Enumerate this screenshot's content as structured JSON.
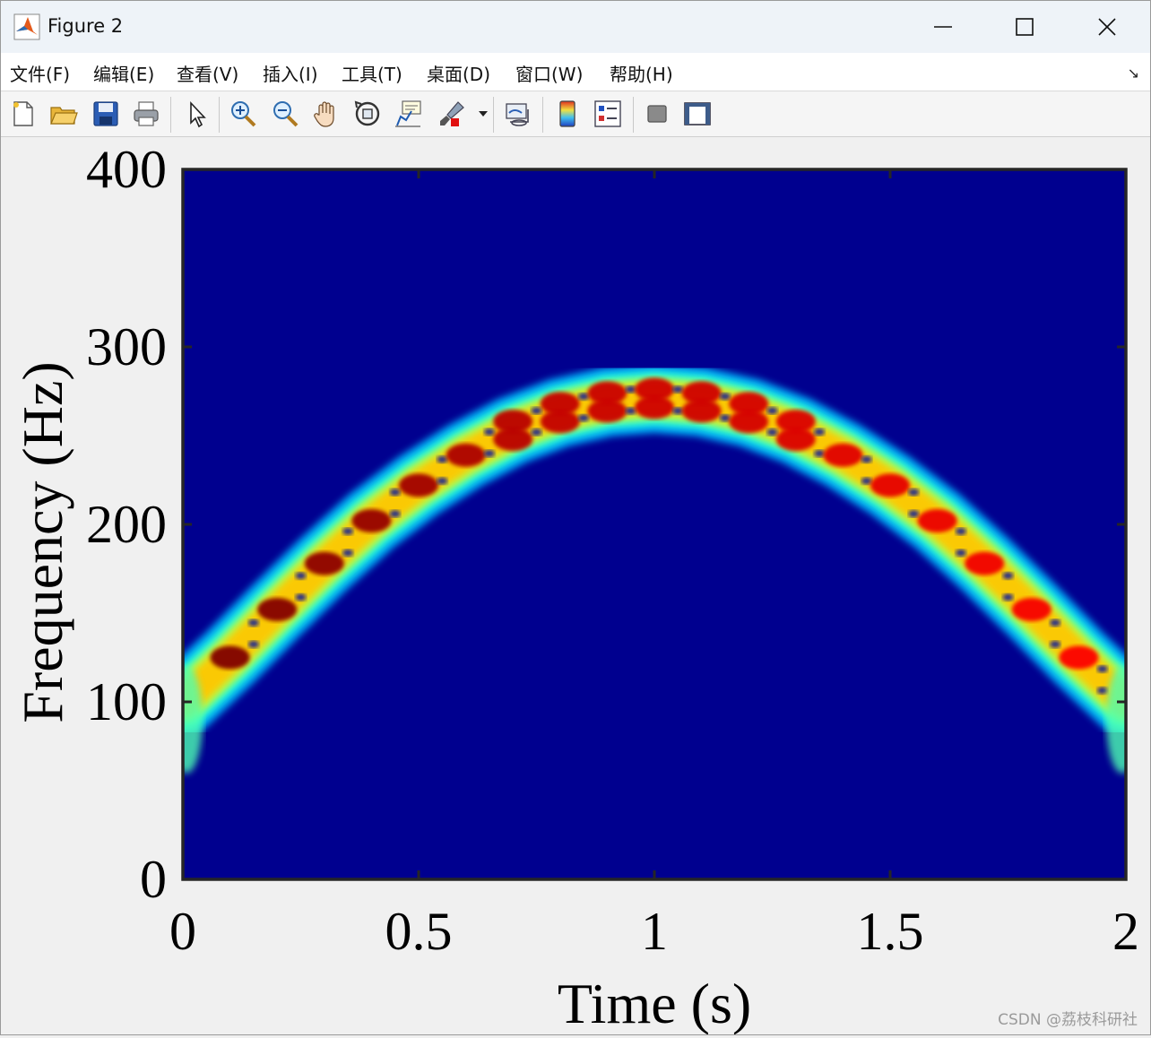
{
  "window": {
    "title": "Figure 2",
    "controls": {
      "minimize": "minimize",
      "maximize": "maximize",
      "close": "close"
    }
  },
  "menu": [
    {
      "label": "文件(F)"
    },
    {
      "label": "编辑(E)"
    },
    {
      "label": "查看(V)"
    },
    {
      "label": "插入(I)"
    },
    {
      "label": "工具(T)"
    },
    {
      "label": "桌面(D)"
    },
    {
      "label": "窗口(W)"
    },
    {
      "label": "帮助(H)"
    }
  ],
  "toolbar": {
    "icons": [
      "new-figure-icon",
      "open-file-icon",
      "save-icon",
      "print-icon",
      "select-pointer-icon",
      "zoom-in-icon",
      "zoom-out-icon",
      "pan-hand-icon",
      "rotate-3d-icon",
      "data-cursor-icon",
      "brush-icon",
      "link-plot-icon",
      "colorbar-icon",
      "legend-icon",
      "hide-plot-tools-icon",
      "show-plot-tools-icon"
    ]
  },
  "watermark": "CSDN @荔枝科研社",
  "chart_data": {
    "type": "heatmap",
    "title": "",
    "xlabel": "Time (s)",
    "ylabel": "Frequency (Hz)",
    "xlim": [
      0,
      2
    ],
    "ylim": [
      0,
      400
    ],
    "xticks": [
      "0",
      "0.5",
      "1",
      "1.5",
      "2"
    ],
    "yticks": [
      "0",
      "100",
      "200",
      "300",
      "400"
    ],
    "colormap": "jet",
    "background_color": "#00008f",
    "ridge": {
      "description_points_t": [
        0,
        0.1,
        0.2,
        0.3,
        0.4,
        0.5,
        0.6,
        0.7,
        0.8,
        0.9,
        1.0,
        1.1,
        1.2,
        1.3,
        1.4,
        1.5,
        1.6,
        1.7,
        1.8,
        1.9,
        2.0
      ],
      "center_freq_hz": [
        100,
        125,
        152,
        178,
        202,
        222,
        239,
        253,
        263,
        269,
        271,
        269,
        263,
        253,
        239,
        222,
        202,
        178,
        152,
        125,
        100
      ],
      "peak_intensity": [
        0.7,
        1.0,
        0.98,
        0.95,
        0.92,
        0.88,
        0.84,
        0.8,
        0.76,
        0.74,
        0.72,
        0.72,
        0.7,
        0.68,
        0.66,
        0.64,
        0.62,
        0.6,
        0.58,
        0.56,
        0.52
      ]
    }
  }
}
